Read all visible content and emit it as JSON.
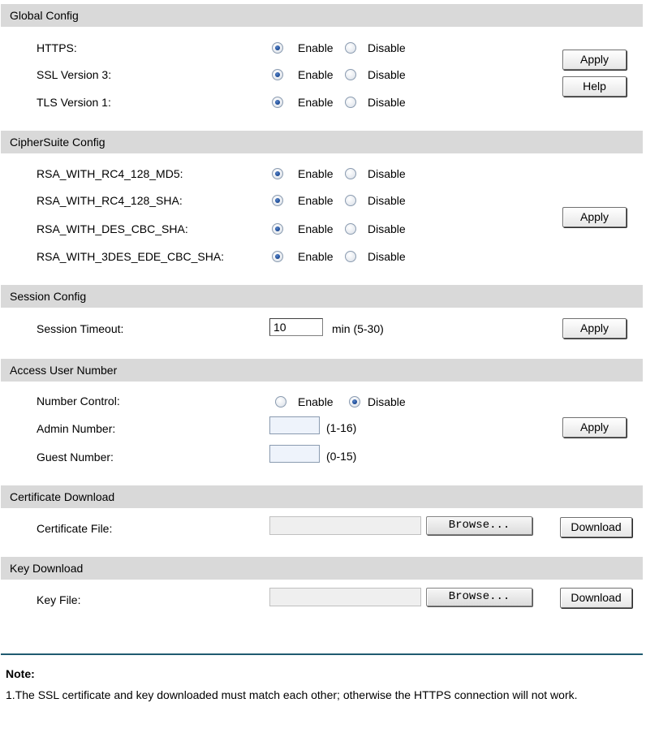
{
  "radio_options": {
    "enable": "Enable",
    "disable": "Disable"
  },
  "global": {
    "header": "Global Config",
    "rows": [
      {
        "label": "HTTPS:",
        "value": "Enable"
      },
      {
        "label": "SSL Version 3:",
        "value": "Enable"
      },
      {
        "label": "TLS Version 1:",
        "value": "Enable"
      }
    ],
    "apply_label": "Apply",
    "help_label": "Help"
  },
  "cipher": {
    "header": "CipherSuite Config",
    "rows": [
      {
        "label": "RSA_WITH_RC4_128_MD5:",
        "value": "Enable"
      },
      {
        "label": "RSA_WITH_RC4_128_SHA:",
        "value": "Enable"
      },
      {
        "label": "RSA_WITH_DES_CBC_SHA:",
        "value": "Enable"
      },
      {
        "label": "RSA_WITH_3DES_EDE_CBC_SHA:",
        "value": "Enable"
      }
    ],
    "apply_label": "Apply"
  },
  "session": {
    "header": "Session Config",
    "timeout_label": "Session Timeout:",
    "timeout_value": "10",
    "timeout_unit": "min (5-30)",
    "apply_label": "Apply"
  },
  "access": {
    "header": "Access User Number",
    "number_control_label": "Number Control:",
    "number_control_value": "Disable",
    "admin_label": "Admin Number:",
    "admin_value": "",
    "admin_range": "(1-16)",
    "guest_label": "Guest Number:",
    "guest_value": "",
    "guest_range": "(0-15)",
    "apply_label": "Apply"
  },
  "cert": {
    "header": "Certificate Download",
    "file_label": "Certificate File:",
    "browse_label": "Browse...",
    "download_label": "Download"
  },
  "key": {
    "header": "Key Download",
    "file_label": "Key File:",
    "browse_label": "Browse...",
    "download_label": "Download"
  },
  "note": {
    "heading": "Note:",
    "text": "1.The SSL certificate and key downloaded must match each other; otherwise the HTTPS connection will not work."
  }
}
